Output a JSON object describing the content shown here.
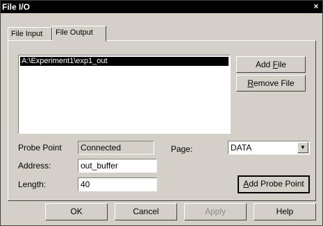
{
  "window": {
    "title": "File I/O",
    "close_glyph": "×"
  },
  "tabs": [
    {
      "label": "File Input",
      "active": false
    },
    {
      "label": "File Output",
      "active": true
    }
  ],
  "file_list": {
    "items": [
      "A:\\Experiment1\\exp1_out"
    ]
  },
  "buttons": {
    "add_file": {
      "pre": "Add ",
      "mn": "F",
      "post": "ile"
    },
    "remove_file": {
      "pre": "",
      "mn": "R",
      "post": "emove File"
    },
    "add_probe_point": {
      "pre": "",
      "mn": "A",
      "post": "dd Probe Point"
    },
    "ok": "OK",
    "cancel": "Cancel",
    "apply": "Apply",
    "help": "Help"
  },
  "form": {
    "probe_point_label": "Probe Point",
    "probe_point_value": "Connected",
    "address_label": "Address:",
    "address_value": "out_buffer",
    "length_label": "Length:",
    "length_value": "40",
    "page_label": "Page:",
    "page_value": "DATA"
  }
}
